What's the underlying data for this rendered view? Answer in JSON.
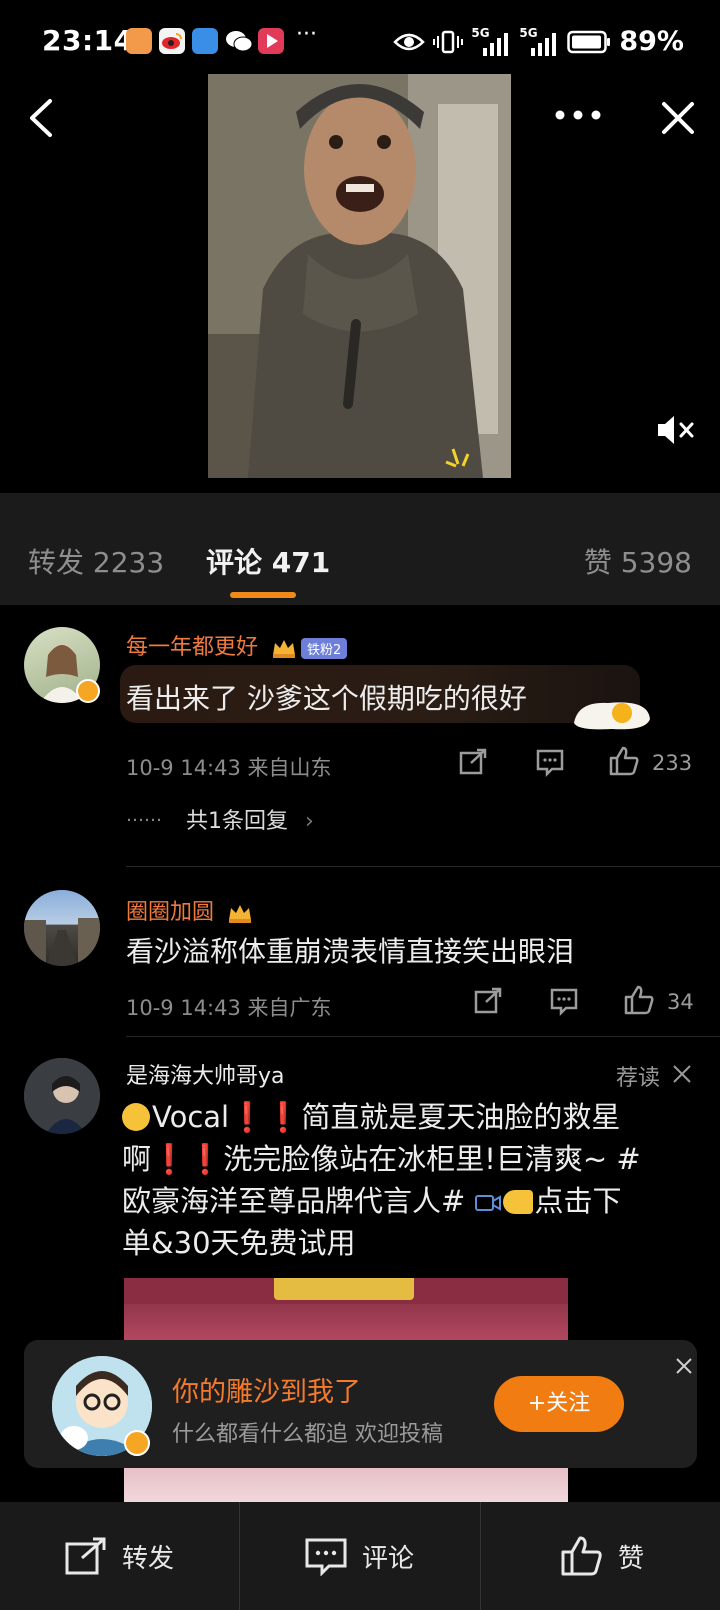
{
  "status_bar": {
    "time": "23:14",
    "more": "···",
    "battery": "89%",
    "network_1": "5G",
    "network_2": "5G"
  },
  "tabs": {
    "repost_label": "转发 2233",
    "comment_label": "评论 471",
    "like_label": "赞 5398"
  },
  "comments": [
    {
      "name": "每一年都更好",
      "fan_badge": "铁粉2",
      "text": "看出来了 沙爹这个假期吃的很好",
      "meta": "10-9 14:43 来自山东",
      "likes": "233",
      "replies": "共1条回复",
      "ellipsis": "……"
    },
    {
      "name": "圈圈加圆",
      "text": "看沙溢称体重崩溃表情直接笑出眼泪",
      "meta": "10-9 14:43 来自广东",
      "likes": "34"
    },
    {
      "name": "是海海大帅哥ya",
      "tag": "荐读",
      "text_lines": [
        "Vocal❗❗简直就是夏天油脸的救星",
        "啊❗❗洗完脸像站在冰柜里!巨清爽~ #",
        "欧豪海洋至尊品牌代言人# ",
        "单&30天免费试用"
      ],
      "text_line3_tail": "点击下"
    }
  ],
  "popup": {
    "title": "你的雕沙到我了",
    "subtitle": "什么都看什么都追 欢迎投稿",
    "follow_label": "+关注"
  },
  "bottom_bar": {
    "repost": "转发",
    "comment": "评论",
    "like": "赞"
  },
  "colors": {
    "accent": "#f08a18",
    "username": "#f07a3e",
    "background": "#000000"
  }
}
